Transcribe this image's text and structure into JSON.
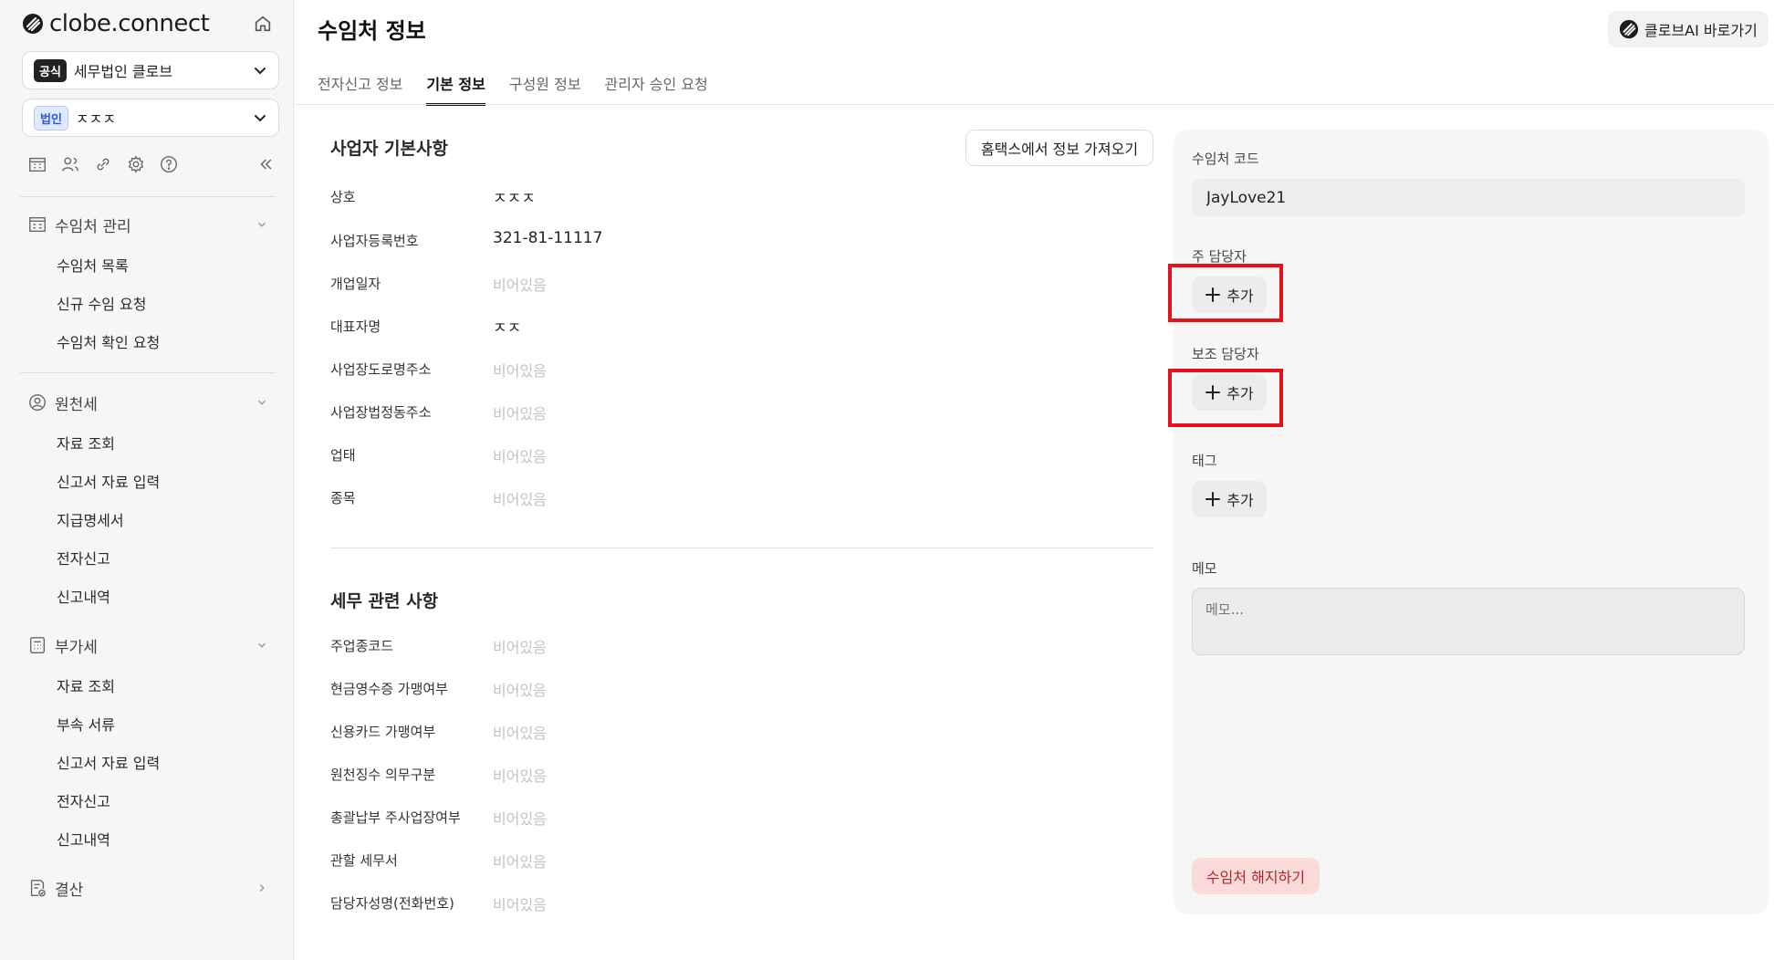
{
  "sidebar": {
    "logo_text": "clobe.connect",
    "office": {
      "badge": "공식",
      "name": "세무법인 클로브"
    },
    "client": {
      "badge": "법인",
      "name": "ㅈㅈㅈ"
    },
    "sections": [
      {
        "label": "수임처 관리",
        "items": [
          "수임처 목록",
          "신규 수임 요청",
          "수임처 확인 요청"
        ]
      },
      {
        "label": "원천세",
        "items": [
          "자료 조회",
          "신고서 자료 입력",
          "지급명세서",
          "전자신고",
          "신고내역"
        ]
      },
      {
        "label": "부가세",
        "items": [
          "자료 조회",
          "부속 서류",
          "신고서 자료 입력",
          "전자신고",
          "신고내역"
        ]
      },
      {
        "label": "결산",
        "items": []
      }
    ]
  },
  "header": {
    "title": "수임처 정보",
    "ai_button": "클로브AI 바로가기"
  },
  "tabs": [
    {
      "label": "전자신고 정보",
      "active": false
    },
    {
      "label": "기본 정보",
      "active": true
    },
    {
      "label": "구성원 정보",
      "active": false
    },
    {
      "label": "관리자 승인 요청",
      "active": false
    }
  ],
  "business": {
    "title": "사업자 기본사항",
    "import_button": "홈택스에서 정보 가져오기",
    "rows": [
      {
        "label": "상호",
        "value": "ㅈㅈㅈ",
        "empty": false
      },
      {
        "label": "사업자등록번호",
        "value": "321-81-11117",
        "empty": false
      },
      {
        "label": "개업일자",
        "value": "비어있음",
        "empty": true
      },
      {
        "label": "대표자명",
        "value": "ㅈㅈ",
        "empty": false
      },
      {
        "label": "사업장도로명주소",
        "value": "비어있음",
        "empty": true
      },
      {
        "label": "사업장법정동주소",
        "value": "비어있음",
        "empty": true
      },
      {
        "label": "업태",
        "value": "비어있음",
        "empty": true
      },
      {
        "label": "종목",
        "value": "비어있음",
        "empty": true
      }
    ]
  },
  "tax": {
    "title": "세무 관련 사항",
    "rows": [
      {
        "label": "주업종코드",
        "value": "비어있음",
        "empty": true
      },
      {
        "label": "현금영수증 가맹여부",
        "value": "비어있음",
        "empty": true
      },
      {
        "label": "신용카드 가맹여부",
        "value": "비어있음",
        "empty": true
      },
      {
        "label": "원천징수 의무구분",
        "value": "비어있음",
        "empty": true
      },
      {
        "label": "총괄납부 주사업장여부",
        "value": "비어있음",
        "empty": true
      },
      {
        "label": "관할 세무서",
        "value": "비어있음",
        "empty": true
      },
      {
        "label": "담당자성명(전화번호)",
        "value": "비어있음",
        "empty": true
      }
    ]
  },
  "panel": {
    "code_label": "수임처 코드",
    "code_value": "JayLove21",
    "primary_manager_label": "주 담당자",
    "secondary_manager_label": "보조 담당자",
    "tag_label": "태그",
    "add_label": "추가",
    "memo_label": "메모",
    "memo_placeholder": "메모...",
    "terminate_button": "수임처 해지하기"
  },
  "colors": {
    "highlight": "#e8111b",
    "danger_bg": "#fbdada",
    "danger_text": "#b3262d"
  }
}
